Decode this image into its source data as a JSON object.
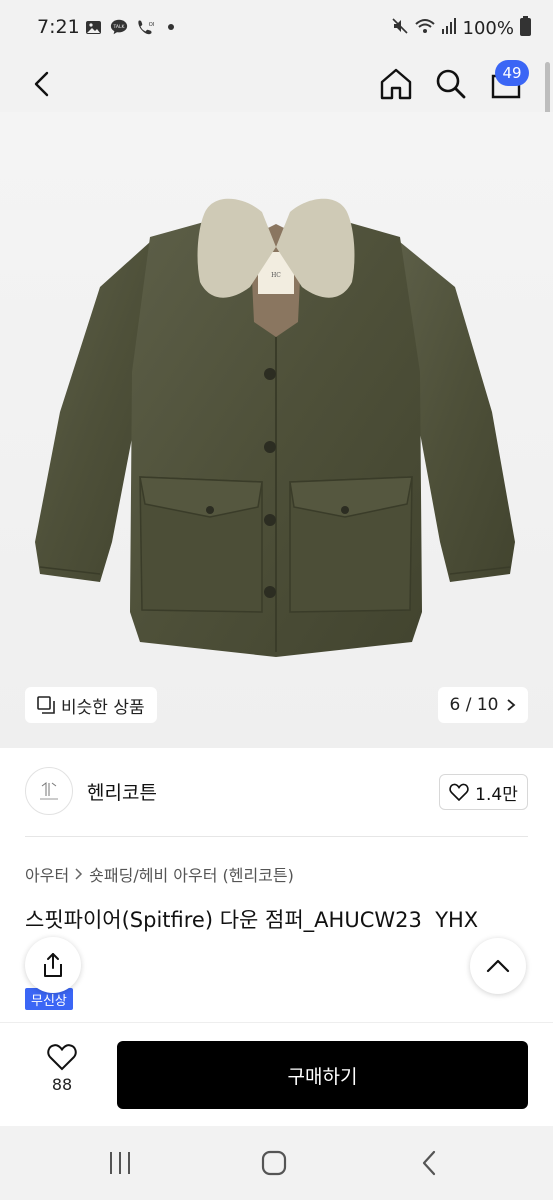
{
  "status_bar": {
    "time": "7:21",
    "battery": "100%",
    "left_icons": [
      "gallery-icon",
      "talk-icon",
      "call-icon",
      "dot-icon"
    ],
    "right_icons": [
      "mute-icon",
      "wifi-icon",
      "signal-icon",
      "battery-icon"
    ]
  },
  "nav": {
    "cart_count": "49"
  },
  "gallery": {
    "similar_label": "비슷한 상품",
    "page_indicator": "6 / 10"
  },
  "brand": {
    "name": "헨리코튼",
    "likes": "1.4만"
  },
  "breadcrumb": {
    "category": "아우터",
    "subcategory": "숏패딩/헤비 아우터 (헨리코튼)"
  },
  "product": {
    "title": "스핏파이어(Spitfire) 다운 점퍼_AHUCW23 ​   YHX",
    "free_shipping_badge": "무신상"
  },
  "action_bar": {
    "wish_count": "88",
    "buy_label": "구매하기"
  },
  "colors": {
    "accent": "#3b66f5",
    "buy_button": "#000000"
  }
}
